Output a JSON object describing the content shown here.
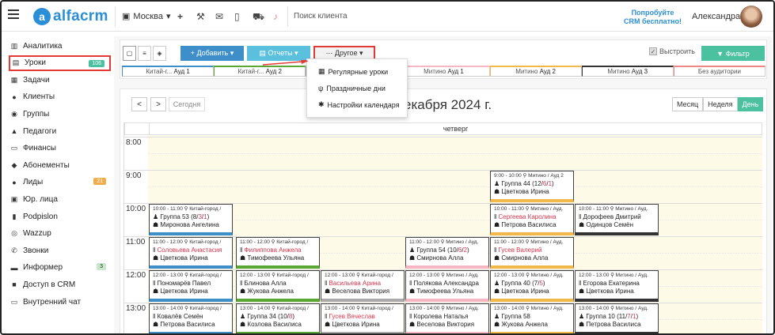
{
  "app": {
    "logo_letter": "a",
    "logo_text": "alfacrm"
  },
  "header": {
    "branch": "Москва",
    "search_placeholder": "Поиск клиента",
    "promo_line1": "Попробуйте",
    "promo_line2": "CRM бесплатно!",
    "user_name": "Александра"
  },
  "sidebar": {
    "items": [
      {
        "label": "Аналитика",
        "icon": "chart-icon",
        "glyph": "▥"
      },
      {
        "label": "Уроки",
        "icon": "book-icon",
        "glyph": "▤",
        "badge": "106",
        "badge_color": "#4cc1a0"
      },
      {
        "label": "Задачи",
        "icon": "tasks-icon",
        "glyph": "▦"
      },
      {
        "label": "Клиенты",
        "icon": "user-icon",
        "glyph": "●"
      },
      {
        "label": "Группы",
        "icon": "group-icon",
        "glyph": "◉"
      },
      {
        "label": "Педагоги",
        "icon": "teacher-icon",
        "glyph": "▲"
      },
      {
        "label": "Финансы",
        "icon": "money-icon",
        "glyph": "▭"
      },
      {
        "label": "Абонементы",
        "icon": "ticket-icon",
        "glyph": "◆"
      },
      {
        "label": "Лиды",
        "icon": "leads-icon",
        "glyph": "●",
        "badge": "21",
        "badge_color": "#f0ad4e"
      },
      {
        "label": "Юр. лица",
        "icon": "building-icon",
        "glyph": "▣"
      },
      {
        "label": "Podpislon",
        "icon": "document-icon",
        "glyph": "▮"
      },
      {
        "label": "Wazzup",
        "icon": "whatsapp-icon",
        "glyph": "◎"
      },
      {
        "label": "Звонки",
        "icon": "phone-icon",
        "glyph": "✆"
      },
      {
        "label": "Информер",
        "icon": "informer-icon",
        "glyph": "▬",
        "badge": "3",
        "badge_color": "#c8e6c9",
        "badge_text_color": "#333"
      },
      {
        "label": "Доступ в CRM",
        "icon": "lock-icon",
        "glyph": "■"
      },
      {
        "label": "Внутренний чат",
        "icon": "chat-icon",
        "glyph": "▭"
      }
    ]
  },
  "toolbar": {
    "add_label": "+ Добавить ▾",
    "reports_label": "▤ Отчеты ▾",
    "other_label": "··· Другое ▾",
    "align_label": "Выстроить",
    "filter_label": "▼ Фильтр"
  },
  "rooms": [
    {
      "prefix": "Китай-г...",
      "name": "Ауд 1",
      "color": "#3d8ec9"
    },
    {
      "prefix": "Китай-г...",
      "name": "Ауд 2",
      "color": "#5aa833"
    },
    {
      "prefix": "",
      "name": "",
      "color": "#aaaaaa"
    },
    {
      "prefix": "Митино",
      "name": "Ауд 1",
      "color": "#f6b6c3"
    },
    {
      "prefix": "Митино",
      "name": "Ауд 2",
      "color": "#f0b94a"
    },
    {
      "prefix": "Митино",
      "name": "Ауд 3",
      "color": "#333333"
    },
    {
      "prefix": "Без аудитории",
      "name": "",
      "color": "#e88"
    }
  ],
  "dropdown": {
    "items": [
      {
        "label": "Регулярные уроки",
        "glyph": "▦"
      },
      {
        "label": "Праздничные дни",
        "glyph": "ψ"
      },
      {
        "label": "Настройки календаря",
        "glyph": "✱"
      }
    ]
  },
  "calendar": {
    "prev": "<",
    "next": ">",
    "today": "Сегодня",
    "title": "екабря 2024 г.",
    "views": [
      "Месяц",
      "Неделя",
      "День"
    ],
    "active_view": "День",
    "day_name": "четверг",
    "hours": [
      "8:00",
      "9:00",
      "10:00",
      "11:00",
      "12:00",
      "13:00"
    ]
  },
  "events": [
    {
      "time": "9:00 - 10:00 ⚲ Митино / Ауд 2",
      "group": "Группа 44 (12/",
      "gr": "6",
      "gsep": "/",
      "gb": "1",
      "gend": ")",
      "teacher": "Цветкова Ирина",
      "border": "#f0b94a"
    },
    {
      "time": "10:00 - 11:00 ⚲ Китай-город /",
      "group": "Группа 53 (8/",
      "gr": "3",
      "gsep": "/",
      "gb": "1",
      "gend": ")",
      "teacher": "Миронова Ангелина",
      "border": "#3d8ec9"
    },
    {
      "time": "10:00 - 11:00 ⚲ Митино / Ауд.",
      "student": "Сергеева Каролина",
      "student_red": true,
      "teacher": "Петрова Василиса",
      "border": "#f0b94a"
    },
    {
      "time": "10:00 - 11:00 ⚲ Митино / Ауд.",
      "student": "Дорофеев Дмитрий",
      "student_red": false,
      "teacher": "Одинцов Семён",
      "border": "#333333"
    },
    {
      "time": "11:00 - 12:00 ⚲ Китай-город /",
      "student": "Соловьева Анастасия",
      "student_red": true,
      "teacher": "Цветкова Ирина",
      "border": "#3d8ec9"
    },
    {
      "time": "11:00 - 12:00 ⚲ Китай-город /",
      "student": "Филиппова Анжела",
      "student_red": true,
      "teacher": "Тимофеева Ульяна",
      "border": "#5aa833"
    },
    {
      "time": "11:00 - 12:00 ⚲ Митино / Ауд.",
      "group": "Группа 54 (10/",
      "gr": "6",
      "gsep": "/",
      "gb": "2",
      "gend": ")",
      "teacher": "Смирнова Алла",
      "border": "#f6b6c3"
    },
    {
      "time": "11:00 - 12:00 ⚲ Митино / Ауд.",
      "student": "Гусев Валерий",
      "student_red": true,
      "teacher": "Смирнова Алла",
      "border": "#f0b94a"
    },
    {
      "time": "12:00 - 13:00 ⚲ Китай-город /",
      "student": "Пономарёв Павел",
      "student_red": false,
      "teacher": "Цветкова Ирина",
      "border": "#3d8ec9"
    },
    {
      "time": "12:00 - 13:00 ⚲ Китай-город /",
      "student": "Блинова Алла",
      "student_red": false,
      "teacher": "Жукова Анжела",
      "border": "#5aa833"
    },
    {
      "time": "12:00 - 13:00 ⚲ Китай-город /",
      "student": "Васильева Арина",
      "student_red": true,
      "teacher": "Веселова Виктория",
      "border": "#aaaaaa"
    },
    {
      "time": "12:00 - 13:00 ⚲ Митино / Ауд.",
      "student": "Полякова Александра",
      "student_red": false,
      "teacher": "Тимофеева Ульяна",
      "border": "#f6b6c3"
    },
    {
      "time": "12:00 - 13:00 ⚲ Митино / Ауд.",
      "group": "Группа 40 (7/",
      "gr": "5",
      "gsep": "",
      "gb": "",
      "gend": ")",
      "teacher": "Цветкова Ирина",
      "border": "#f0b94a"
    },
    {
      "time": "12:00 - 13:00 ⚲ Митино / Ауд.",
      "student": "Егорова Екатерина",
      "student_red": false,
      "teacher": "Цветкова Ирина",
      "border": "#333333"
    },
    {
      "time": "13:00 - 14:00 ⚲ Китай-город /",
      "student": "Ковалёв Семён",
      "student_red": false,
      "teacher": "Петрова Василиса",
      "border": "#3d8ec9"
    },
    {
      "time": "13:00 - 14:00 ⚲ Китай-город /",
      "group": "Группа 34 (10/",
      "gr": "8",
      "gsep": "",
      "gb": "",
      "gend": ")",
      "teacher": "Козлова Василиса",
      "border": "#5aa833"
    },
    {
      "time": "13:00 - 14:00 ⚲ Китай-город /",
      "student": "Гусев Вячеслав",
      "student_red": true,
      "teacher": "Цветкова Ирина",
      "border": "#aaaaaa"
    },
    {
      "time": "13:00 - 14:00 ⚲ Митино / Ауд.",
      "student": "Королева Наталья",
      "student_red": false,
      "teacher": "Веселова Виктория",
      "border": "#f6b6c3"
    },
    {
      "time": "13:00 - 14:00 ⚲ Митино / Ауд.",
      "group": "Группа 58",
      "gr": "",
      "gsep": "",
      "gb": "",
      "gend": "",
      "teacher": "Жукова Анжела",
      "border": "#f0b94a"
    },
    {
      "time": "13:00 - 14:00 ⚲ Митино / Ауд.",
      "group": "Группа 10 (11/",
      "gr": "7",
      "gsep": "/",
      "gb": "1",
      "gend": ")",
      "teacher": "Петрова Василиса",
      "border": "#333333"
    }
  ]
}
